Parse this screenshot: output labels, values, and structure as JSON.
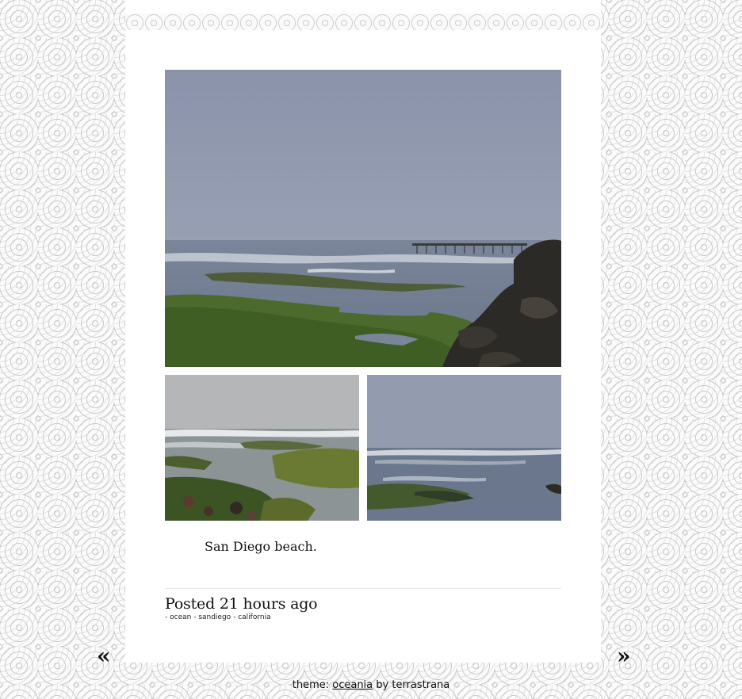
{
  "post": {
    "caption": "San Diego beach.",
    "posted": "Posted 21 hours ago",
    "tags": [
      "ocean",
      "sandiego",
      "california"
    ],
    "tag_separator": " - "
  },
  "navigation": {
    "prev_glyph": "«",
    "next_glyph": "»"
  },
  "footer": {
    "prefix": "theme: ",
    "theme_link": "oceania",
    "suffix": " by terrastrana"
  },
  "colors": {
    "sky": "#8f97ad",
    "sea": "#6f7c92",
    "algae": "#4b6a2c",
    "rock": "#2c2a26"
  }
}
